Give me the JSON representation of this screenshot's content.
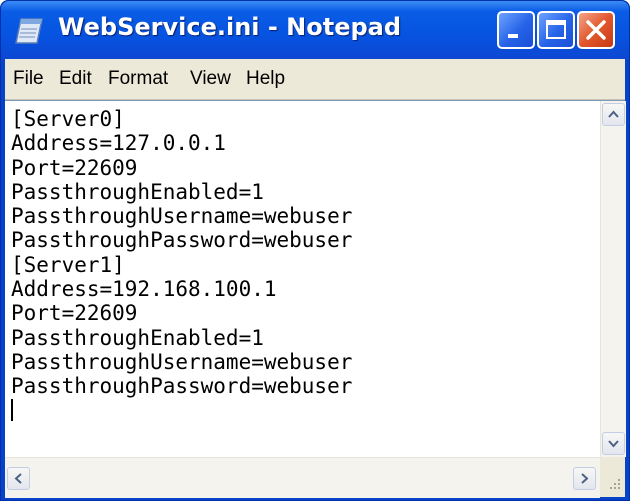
{
  "window": {
    "title": "WebService.ini - Notepad",
    "titlebar_color": "#0653e0",
    "close_button_color": "#e2582e"
  },
  "menu": {
    "items": [
      "File",
      "Edit",
      "Format",
      "View",
      "Help"
    ]
  },
  "editor": {
    "content": "[Server0]\nAddress=127.0.0.1\nPort=22609\nPassthroughEnabled=1\nPassthroughUsername=webuser\nPassthroughPassword=webuser\n[Server1]\nAddress=192.168.100.1\nPort=22609\nPassthroughEnabled=1\nPassthroughUsername=webuser\nPassthroughPassword=webuser\n"
  },
  "icons": {
    "app": "notepad-icon",
    "minimize": "minimize-icon",
    "maximize": "maximize-icon",
    "close": "close-icon",
    "scroll_up": "arrow-up-icon",
    "scroll_down": "arrow-down-icon",
    "scroll_left": "arrow-left-icon",
    "scroll_right": "arrow-right-icon",
    "resize": "resize-grip-icon"
  }
}
